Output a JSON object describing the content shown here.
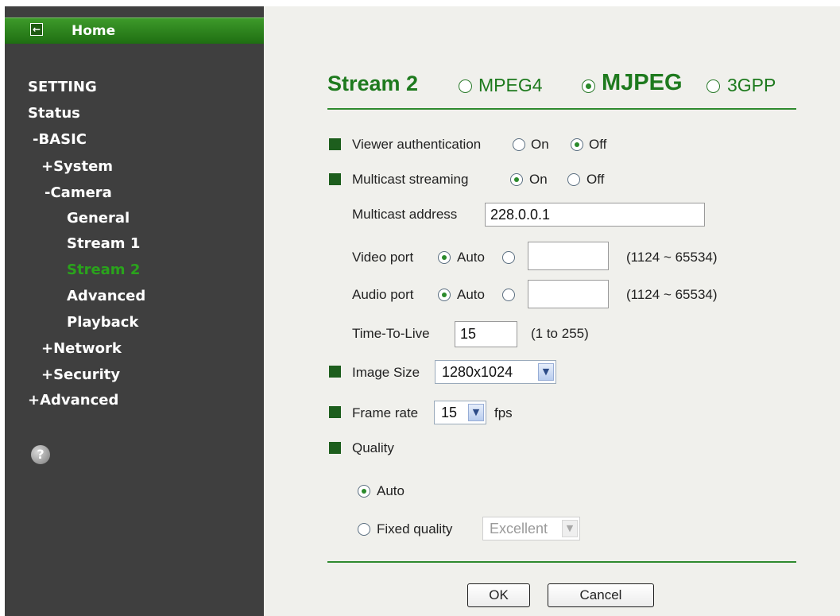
{
  "sidebar": {
    "home_label": "Home",
    "items": [
      {
        "label": "SETTING"
      },
      {
        "label": "Status"
      },
      {
        "label": "-BASIC"
      },
      {
        "label": "+System"
      },
      {
        "label": "-Camera"
      },
      {
        "label": "General"
      },
      {
        "label": "Stream 1"
      },
      {
        "label": "Stream 2"
      },
      {
        "label": "Advanced"
      },
      {
        "label": "Playback"
      },
      {
        "label": "+Network"
      },
      {
        "label": "+Security"
      },
      {
        "label": "+Advanced"
      }
    ],
    "help_symbol": "?"
  },
  "header": {
    "title": "Stream 2",
    "formats": [
      {
        "label": "MPEG4",
        "selected": false
      },
      {
        "label": "MJPEG",
        "selected": true
      },
      {
        "label": "3GPP",
        "selected": false
      }
    ]
  },
  "form": {
    "viewer_auth": {
      "label": "Viewer authentication",
      "on": "On",
      "off": "Off",
      "value": "Off"
    },
    "multicast": {
      "label": "Multicast streaming",
      "on": "On",
      "off": "Off",
      "value": "On"
    },
    "multicast_address": {
      "label": "Multicast address",
      "value": "228.0.0.1"
    },
    "video_port": {
      "label": "Video port",
      "auto": "Auto",
      "value": "",
      "range": "(1124 ~ 65534)"
    },
    "audio_port": {
      "label": "Audio port",
      "auto": "Auto",
      "value": "",
      "range": "(1124 ~ 65534)"
    },
    "ttl": {
      "label": "Time-To-Live",
      "value": "15",
      "range": "(1 to 255)"
    },
    "image_size": {
      "label": "Image Size",
      "value": "1280x1024"
    },
    "frame_rate": {
      "label": "Frame rate",
      "value": "15",
      "unit": "fps"
    },
    "quality": {
      "label": "Quality",
      "auto": "Auto",
      "fixed": "Fixed quality",
      "fixed_value": "Excellent",
      "value": "Auto"
    }
  },
  "buttons": {
    "ok": "OK",
    "cancel": "Cancel"
  },
  "colors": {
    "accent_green": "#1e7a1e",
    "sidebar_bg": "#3f3f3f",
    "active_nav": "#2aa31c",
    "main_bg": "#f0f0ec"
  },
  "icons": {
    "home": "back-arrow-icon",
    "help": "help-icon",
    "bullet": "square-bullet-icon",
    "dropdown": "chevron-down-icon"
  }
}
